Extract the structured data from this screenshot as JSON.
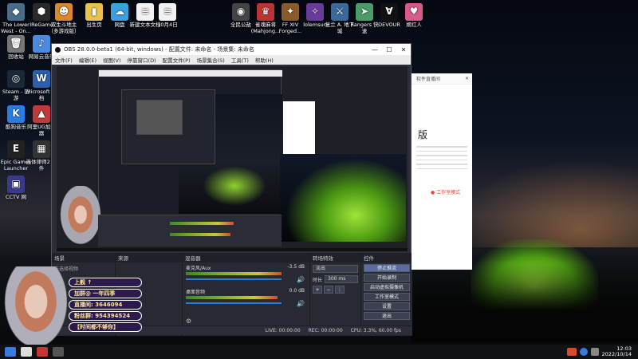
{
  "desktop": {
    "icons": [
      {
        "label": "The Lower West - On...",
        "color": "#4a6b8a",
        "glyph": "◆"
      },
      {
        "label": "IReGame",
        "color": "#2a2a2a",
        "glyph": "⬢"
      },
      {
        "label": "双生斗地主（多游戏版）",
        "color": "#d9892a",
        "glyph": "☻"
      },
      {
        "label": "出生页",
        "color": "#e8c24a",
        "glyph": "▮"
      },
      {
        "label": "网盘",
        "color": "#3aa0e0",
        "glyph": "☁"
      },
      {
        "label": "新建文本文档",
        "color": "#f2f2f2",
        "glyph": "≡"
      },
      {
        "label": "10月4日",
        "color": "#f2f2f2",
        "glyph": "≡"
      },
      {
        "label": "回收站",
        "color": "#777",
        "glyph": "🗑"
      },
      {
        "label": "网易云音乐",
        "color": "#4a8adf",
        "glyph": "♪"
      },
      {
        "label": "Steam - 链游",
        "color": "#1b2838",
        "glyph": "◎"
      },
      {
        "label": "Microsoft 文档",
        "color": "#2b5fb0",
        "glyph": "W"
      },
      {
        "label": "酷狗音乐",
        "color": "#2a7de0",
        "glyph": "K"
      },
      {
        "label": "阿里UG加速器",
        "color": "#c03a3a",
        "glyph": "▲"
      },
      {
        "label": "Epic Games Launcher",
        "color": "#222",
        "glyph": "E"
      },
      {
        "label": "连体律师2 文件",
        "color": "#333",
        "glyph": "▦"
      },
      {
        "label": "CCTV 网",
        "color": "#3a3a8a",
        "glyph": "▣"
      }
    ],
    "right_icons": [
      {
        "label": "全民公敌",
        "color": "#444",
        "glyph": "◉"
      },
      {
        "label": "雀魂麻将 (Mahjong...",
        "color": "#b33",
        "glyph": "♛"
      },
      {
        "label": "FF XIV Forged...",
        "color": "#8a5a2a",
        "glyph": "✦"
      },
      {
        "label": "lolemsun",
        "color": "#6a3a9a",
        "glyph": "✧"
      },
      {
        "label": "复兰 A. 地下城",
        "color": "#3a6a9a",
        "glyph": "⚔"
      },
      {
        "label": "Rangers 快速",
        "color": "#4a9a6a",
        "glyph": "➤"
      },
      {
        "label": "DEVOUR",
        "color": "#111",
        "glyph": "Ɐ"
      },
      {
        "label": "姬红人",
        "color": "#d85a8a",
        "glyph": "♥"
      }
    ]
  },
  "obs": {
    "title": "OBS 28.0.0-beta1 (64-bit, windows) - 配置文件: 未命名 - 场景集: 未命名",
    "menus": [
      "文件(F)",
      "编辑(E)",
      "视图(V)",
      "停靠窗口(D)",
      "配置文件(P)",
      "场景集合(S)",
      "工具(T)",
      "帮助(H)"
    ],
    "docks": {
      "scenes": "场景",
      "sources": "来源",
      "mixer": "混音器",
      "transitions": "转场特效",
      "controls": "控件"
    },
    "scene_label": "未选择视频",
    "mixer": {
      "tracks": [
        {
          "name": "麦克风/Aux",
          "db": "-3.5 dB",
          "level": 0.86
        },
        {
          "name": "桌面音频",
          "db": "0.0 dB",
          "level": 0.82
        }
      ]
    },
    "transition": {
      "type": "淡出",
      "duration_label": "时长",
      "duration": "300 ms"
    },
    "controls": [
      "停止推流",
      "开始录制",
      "启动虚拟摄像机",
      "工作室模式",
      "设置",
      "退出"
    ],
    "status": {
      "live": "LIVE: 00:00:00",
      "rec": "REC: 00:00:00",
      "cpu": "CPU: 3.3%, 60.00 fps"
    }
  },
  "side_panel": {
    "header_title": "软件直播间",
    "heading": "版",
    "status_text": "● 工作室模式"
  },
  "overlay": {
    "lines": [
      "上舰 ↑",
      "加群@ 一年四季",
      "直播间: 3646094",
      "粉丝群: 954394524",
      "【时间都不够你】"
    ]
  },
  "taskbar": {
    "time": "12:03",
    "date": "2022/10/14"
  }
}
